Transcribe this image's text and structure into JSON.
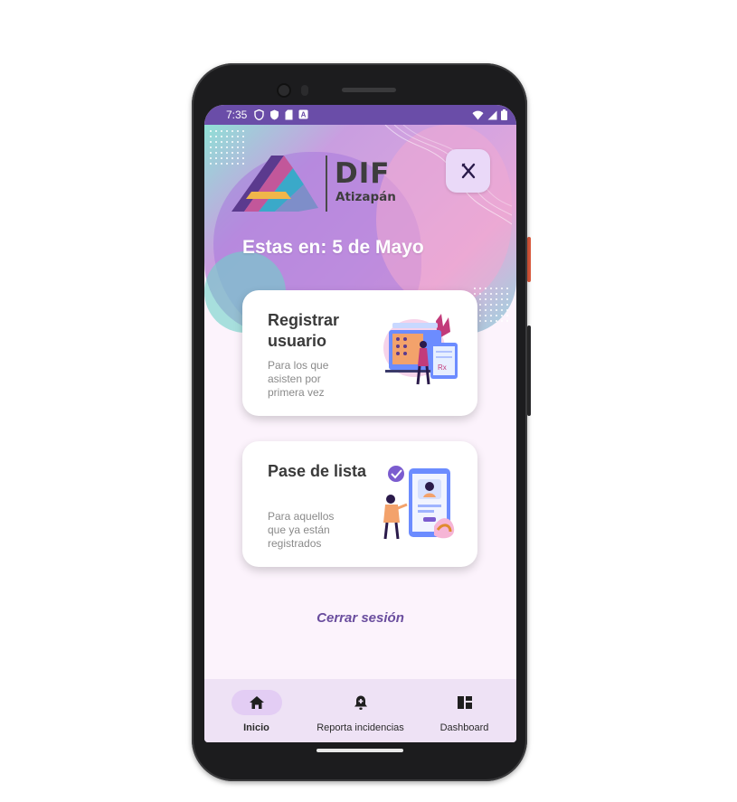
{
  "status_bar": {
    "time": "7:35",
    "left_icons": [
      "shield-icon",
      "vpn-shield-icon",
      "sim-card-icon",
      "notification-a-icon"
    ],
    "right_icons": [
      "wifi-icon",
      "signal-icon",
      "battery-icon"
    ]
  },
  "header": {
    "logo_title": "DIF",
    "logo_subtitle": "Atizapán",
    "menu_icon": "fork-knife-icon",
    "date_text": "Estas en: 5 de Mayo"
  },
  "cards": [
    {
      "title": "Registrar usuario",
      "description": "Para los que asisten por primera vez",
      "illustration": "registration-illustration"
    },
    {
      "title": "Pase de lista",
      "description": "Para aquellos que ya están registrados",
      "illustration": "attendance-illustration"
    }
  ],
  "logout_label": "Cerrar sesión",
  "bottom_nav": [
    {
      "label": "Inicio",
      "icon": "home-icon",
      "active": true
    },
    {
      "label": "Reporta incidencias",
      "icon": "bell-plus-icon",
      "active": false
    },
    {
      "label": "Dashboard",
      "icon": "dashboard-icon",
      "active": false
    }
  ],
  "colors": {
    "status_bar": "#6a4da8",
    "accent": "#6a4d9e",
    "nav_bg": "#eee2f5",
    "nav_active_pill": "#e3cdf4",
    "screen_bg": "#fcf3fc"
  }
}
